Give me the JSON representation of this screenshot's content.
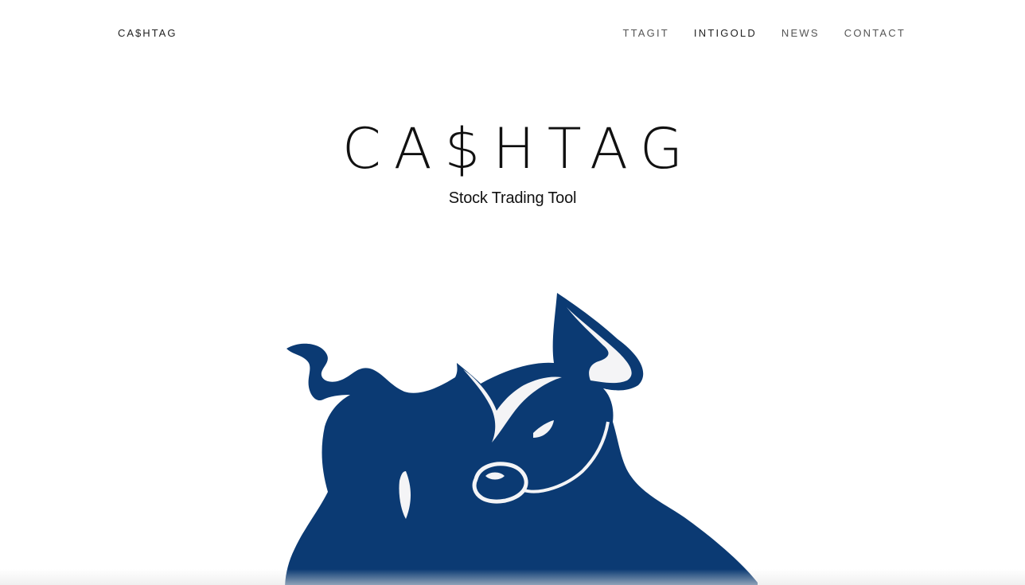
{
  "nav": {
    "brand": "CA$HTAG",
    "links": [
      {
        "label": "TTAGIT"
      },
      {
        "label": "INTIGOLD"
      },
      {
        "label": "NEWS"
      },
      {
        "label": "CONTACT"
      }
    ]
  },
  "hero": {
    "title": "CA$HTAG",
    "subtitle": "Stock Trading Tool"
  },
  "illustration": {
    "icon": "bull-icon",
    "color": "#0b3a73",
    "highlight_color": "#f4f4f6"
  }
}
